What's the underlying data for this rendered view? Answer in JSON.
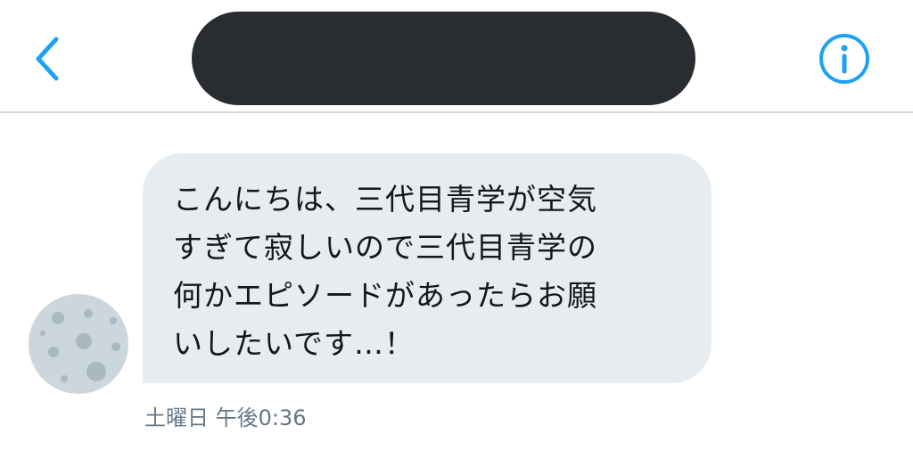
{
  "header": {
    "back_icon": "chevron-left-icon",
    "info_icon": "info-circle-icon",
    "accent_color": "#1da1f2"
  },
  "conversation": {
    "message": {
      "lines": [
        "こんにちは、三代目青学が空気",
        "すぎて寂しいので三代目青学の",
        "何かエピソードがあったらお願",
        "いしたいです…！"
      ],
      "timestamp": "土曜日 午後0:36",
      "bubble_color": "#e6ecf0"
    },
    "avatar_icon": "moon-avatar-icon"
  }
}
